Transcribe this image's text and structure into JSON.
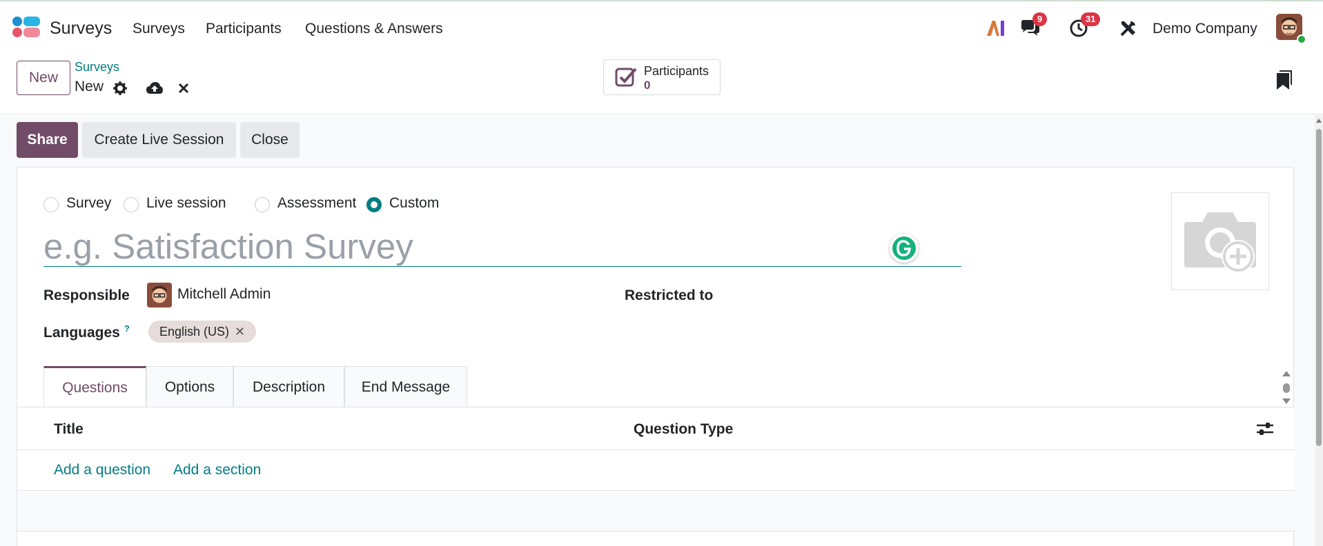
{
  "app": {
    "name": "Surveys"
  },
  "nav": {
    "items": [
      {
        "label": "Surveys"
      },
      {
        "label": "Participants"
      },
      {
        "label": "Questions & Answers"
      }
    ],
    "messages_badge": "9",
    "activities_badge": "31",
    "company": "Demo Company"
  },
  "control": {
    "new_button": "New",
    "breadcrumb_parent": "Surveys",
    "breadcrumb_current": "New",
    "smart_button_label": "Participants",
    "smart_button_value": "0"
  },
  "statusbar": {
    "share": "Share",
    "create_live_session": "Create Live Session",
    "close": "Close"
  },
  "form": {
    "survey_types": [
      {
        "label": "Survey",
        "checked": false
      },
      {
        "label": "Live session",
        "checked": false
      },
      {
        "label": "Assessment",
        "checked": false
      },
      {
        "label": "Custom",
        "checked": true
      }
    ],
    "title_placeholder": "e.g. Satisfaction Survey",
    "responsible_label": "Responsible",
    "responsible_value": "Mitchell Admin",
    "restricted_label": "Restricted to",
    "languages_label": "Languages",
    "languages_help": "?",
    "language_tag": "English (US)",
    "tag_remove": "✕"
  },
  "tabs": [
    {
      "label": "Questions",
      "active": true
    },
    {
      "label": "Options",
      "active": false
    },
    {
      "label": "Description",
      "active": false
    },
    {
      "label": "End Message",
      "active": false
    }
  ],
  "list": {
    "col_title": "Title",
    "col_question_type": "Question Type",
    "add_question": "Add a question",
    "add_section": "Add a section"
  },
  "colors": {
    "primary": "#714b67",
    "accent": "#017e84",
    "badge": "#dc3545"
  }
}
